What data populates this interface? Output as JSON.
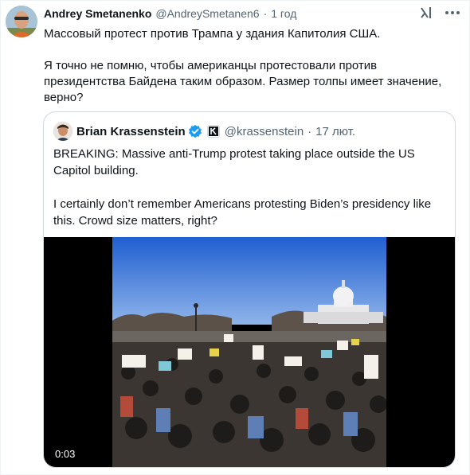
{
  "post": {
    "author_name": "Andrey Smetanenko",
    "author_handle": "@AndreySmetanen6",
    "time": "1 год",
    "text_line1": "Массовый протест против Трампа у здания Капитолия США.",
    "text_line2": "Я точно не помню, чтобы американцы протестовали против президентства Байдена таким образом. Размер толпы имеет значение, верно?"
  },
  "quoted": {
    "author_name": "Brian Krassenstein",
    "author_handle": "@krassenstein",
    "time": "17 лют.",
    "text_line1": "BREAKING: Massive anti-Trump protest taking place outside the US Capitol building.",
    "text_line2": "I certainly don’t remember Americans protesting Biden’s presidency like this.   Crowd size matters, right?",
    "video_time": "0:03"
  },
  "icons": {
    "grok": "grok-icon",
    "more": "more-icon",
    "verified": "verified-badge-icon",
    "affiliate": "affiliate-badge-icon"
  },
  "colors": {
    "verified": "#1d9bf0",
    "secondary_text": "#536471",
    "border": "#cfd9de"
  }
}
